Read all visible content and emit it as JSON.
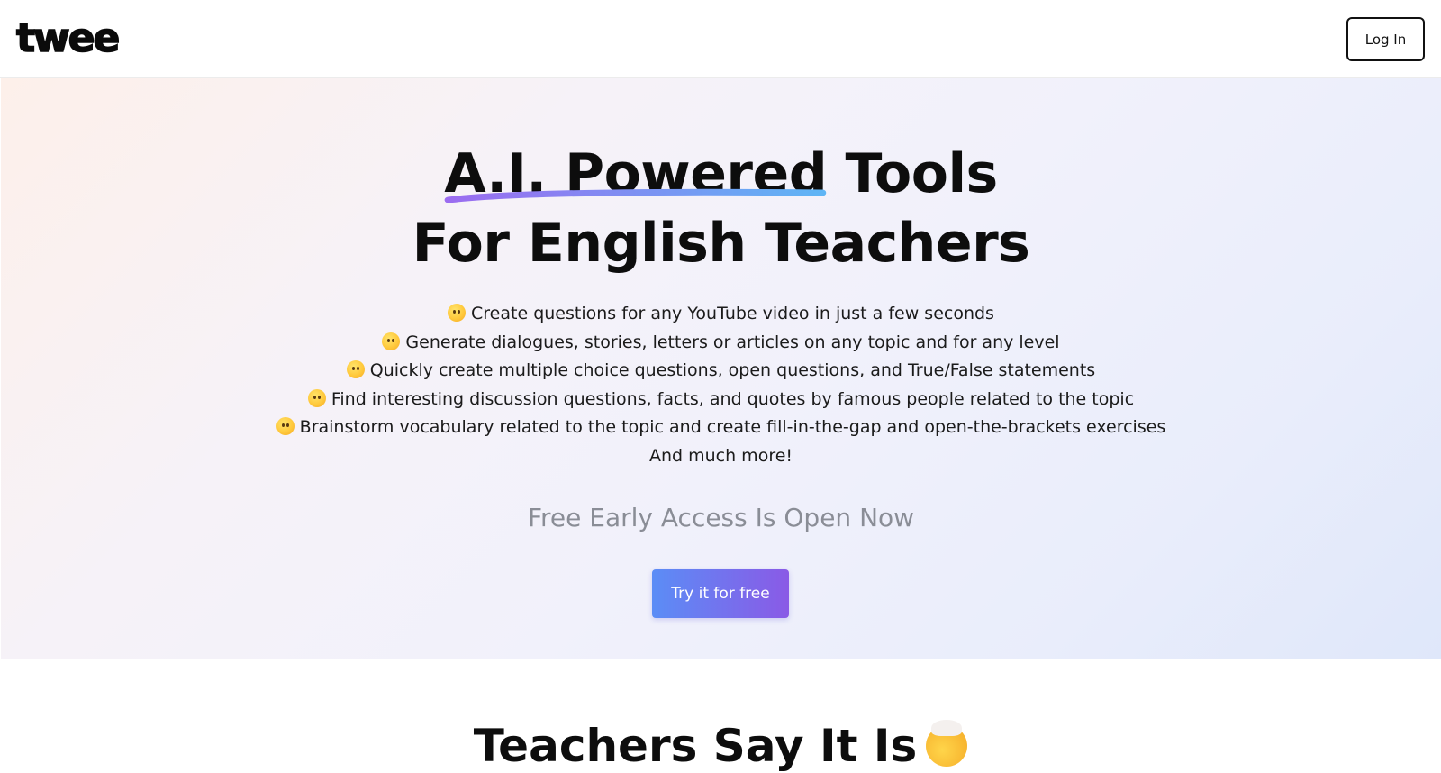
{
  "header": {
    "logo_text": "twee",
    "login_label": "Log In"
  },
  "hero": {
    "title_highlight": "A.I. Powered",
    "title_rest": "Tools",
    "title_line2": "For English Teachers",
    "features": [
      {
        "icon": "exploding-head-emoji-icon",
        "text": "Create questions for any YouTube video in just a few seconds"
      },
      {
        "icon": "astonished-face-emoji-icon",
        "text": "Generate dialogues, stories, letters or articles on any topic and for any level"
      },
      {
        "icon": "screaming-face-emoji-icon",
        "text": "Quickly create multiple choice questions, open questions, and True/False statements"
      },
      {
        "icon": "hand-over-mouth-emoji-icon",
        "text": "Find interesting discussion questions, facts, and quotes by famous people related to the topic"
      },
      {
        "icon": "star-struck-emoji-icon",
        "text": "Brainstorm vocabulary related to the topic and create fill-in-the-gap and open-the-brackets exercises"
      }
    ],
    "features_more": "And much more!",
    "subheading": "Free Early Access Is Open Now",
    "cta_label": "Try it for free"
  },
  "testimonials": {
    "heading": "Teachers Say It Is",
    "heading_icon": "exploding-head-emoji-icon"
  },
  "colors": {
    "cta_gradient_start": "#5b8df6",
    "cta_gradient_end": "#8a5ae6",
    "underline_start": "#9b6cf0",
    "underline_end": "#5fb5f5",
    "subheading": "#8a8d96"
  }
}
